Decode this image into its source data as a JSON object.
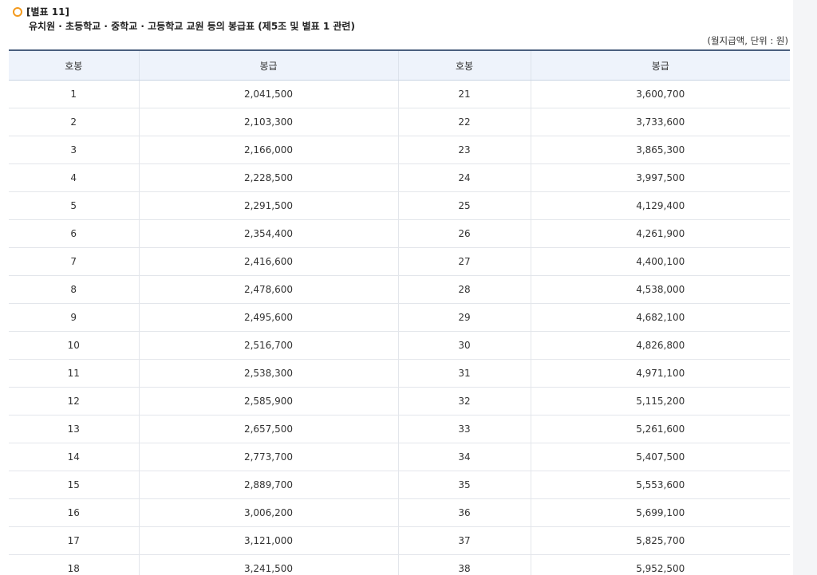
{
  "header": {
    "label": "[별표 11]",
    "subtitle": "유치원 · 초등학교 · 중학교 · 고등학교 교원 등의 봉급표 (제5조 및 별표 1 관련)",
    "unit_note": "(월지급액, 단위 : 원)"
  },
  "table": {
    "columns": [
      "호봉",
      "봉급",
      "호봉",
      "봉급"
    ],
    "rows": [
      [
        "1",
        "2,041,500",
        "21",
        "3,600,700"
      ],
      [
        "2",
        "2,103,300",
        "22",
        "3,733,600"
      ],
      [
        "3",
        "2,166,000",
        "23",
        "3,865,300"
      ],
      [
        "4",
        "2,228,500",
        "24",
        "3,997,500"
      ],
      [
        "5",
        "2,291,500",
        "25",
        "4,129,400"
      ],
      [
        "6",
        "2,354,400",
        "26",
        "4,261,900"
      ],
      [
        "7",
        "2,416,600",
        "27",
        "4,400,100"
      ],
      [
        "8",
        "2,478,600",
        "28",
        "4,538,000"
      ],
      [
        "9",
        "2,495,600",
        "29",
        "4,682,100"
      ],
      [
        "10",
        "2,516,700",
        "30",
        "4,826,800"
      ],
      [
        "11",
        "2,538,300",
        "31",
        "4,971,100"
      ],
      [
        "12",
        "2,585,900",
        "32",
        "5,115,200"
      ],
      [
        "13",
        "2,657,500",
        "33",
        "5,261,600"
      ],
      [
        "14",
        "2,773,700",
        "34",
        "5,407,500"
      ],
      [
        "15",
        "2,889,700",
        "35",
        "5,553,600"
      ],
      [
        "16",
        "3,006,200",
        "36",
        "5,699,100"
      ],
      [
        "17",
        "3,121,000",
        "37",
        "5,825,700"
      ],
      [
        "18",
        "3,241,500",
        "38",
        "5,952,500"
      ]
    ]
  },
  "colors": {
    "bullet": "#f39a1e",
    "header_bg": "#eef3fb",
    "header_rule": "#4a5f7e"
  }
}
